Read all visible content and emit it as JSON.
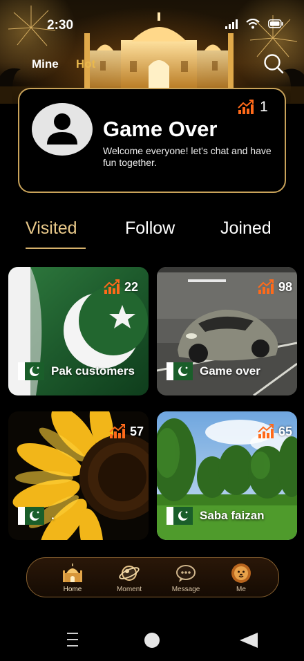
{
  "status_bar": {
    "time": "2:30",
    "icons": [
      "signal-icon",
      "wifi-icon",
      "battery-icon"
    ]
  },
  "top_nav": {
    "tabs": [
      {
        "label": "Mine",
        "active": false
      },
      {
        "label": "Hot",
        "active": true
      }
    ],
    "search_icon": "search-icon"
  },
  "profile": {
    "title": "Game Over",
    "description": "Welcome everyone! let's chat and have fun together.",
    "trend_count": "1",
    "avatar_icon": "user-silhouette-icon"
  },
  "tabs": [
    {
      "label": "Visited",
      "active": true
    },
    {
      "label": "Follow",
      "active": false
    },
    {
      "label": "Joined",
      "active": false
    }
  ],
  "rooms": [
    {
      "name": "Pak customers",
      "count": "22",
      "flag": "pakistan-flag-icon",
      "image": "pakistan-flag-photo"
    },
    {
      "name": "Game over",
      "count": "98",
      "flag": "pakistan-flag-icon",
      "image": "grey-sports-car-photo"
    },
    {
      "name": ".",
      "count": "57",
      "flag": "pakistan-flag-icon",
      "image": "sunflower-photo"
    },
    {
      "name": "Saba faizan",
      "count": "65",
      "flag": "pakistan-flag-icon",
      "image": "green-park-photo"
    }
  ],
  "bottom_nav": {
    "items": [
      {
        "label": "Home",
        "icon": "palace-icon",
        "active": true
      },
      {
        "label": "Moment",
        "icon": "planet-icon",
        "active": false
      },
      {
        "label": "Message",
        "icon": "chat-bubble-icon",
        "active": false
      },
      {
        "label": "Me",
        "icon": "lion-icon",
        "active": false
      }
    ]
  },
  "system_nav": [
    "recent-apps-icon",
    "home-circle-icon",
    "back-triangle-icon"
  ],
  "colors": {
    "accent_gold": "#e9b84d",
    "card_border": "#c9a35a",
    "trend_orange": "#ff6a1a",
    "background": "#000000"
  }
}
